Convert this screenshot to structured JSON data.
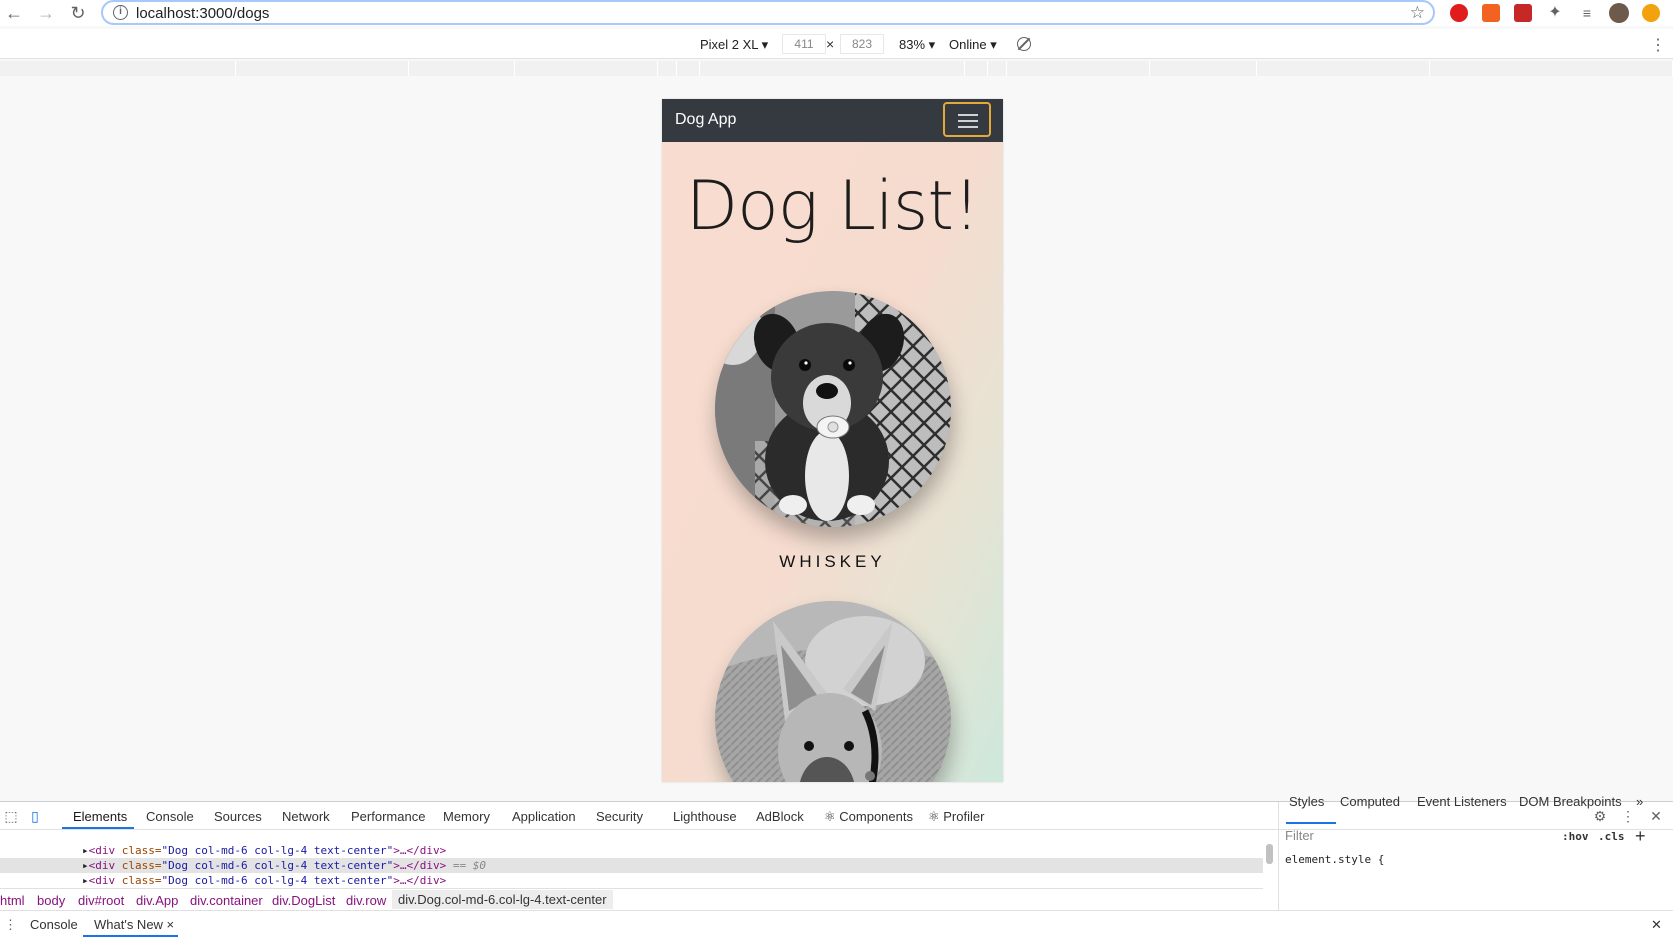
{
  "browser": {
    "url": "localhost:3000/dogs"
  },
  "device_toolbar": {
    "device": "Pixel 2 XL ▾",
    "width": "411",
    "height": "823",
    "zoom": "83% ▾",
    "network": "Online ▾"
  },
  "app": {
    "brand": "Dog App",
    "title": "Dog List!",
    "dogs": [
      {
        "name": "WHISKEY"
      }
    ]
  },
  "devtools": {
    "tabs": [
      "Elements",
      "Console",
      "Sources",
      "Network",
      "Performance",
      "Memory",
      "Application",
      "Security",
      "Lighthouse",
      "AdBlock",
      "⚛ Components",
      "⚛ Profiler"
    ],
    "dom_lines": [
      {
        "open": "<div ",
        "attr": "class=",
        "val": "\"Dog col-md-6 col-lg-4 text-center\"",
        "close": ">…</div>",
        "suffix": ""
      },
      {
        "open": "<div ",
        "attr": "class=",
        "val": "\"Dog col-md-6 col-lg-4 text-center\"",
        "close": ">…</div>",
        "suffix": " == $0"
      },
      {
        "open": "<div ",
        "attr": "class=",
        "val": "\"Dog col-md-6 col-lg-4 text-center\"",
        "close": ">…</div>",
        "suffix": ""
      }
    ],
    "breadcrumbs": [
      "html",
      "body",
      "div#root",
      "div.App",
      "div.container",
      "div.DogList",
      "div.row",
      "div.Dog.col-md-6.col-lg-4.text-center"
    ],
    "styles_tabs": [
      "Styles",
      "Computed",
      "Event Listeners",
      "DOM Breakpoints",
      "»"
    ],
    "filter_placeholder": "Filter",
    "hov": ":hov",
    "cls": ".cls",
    "element_style": "element.style {",
    "drawer_tabs": [
      "Console",
      "What's New ×"
    ]
  }
}
